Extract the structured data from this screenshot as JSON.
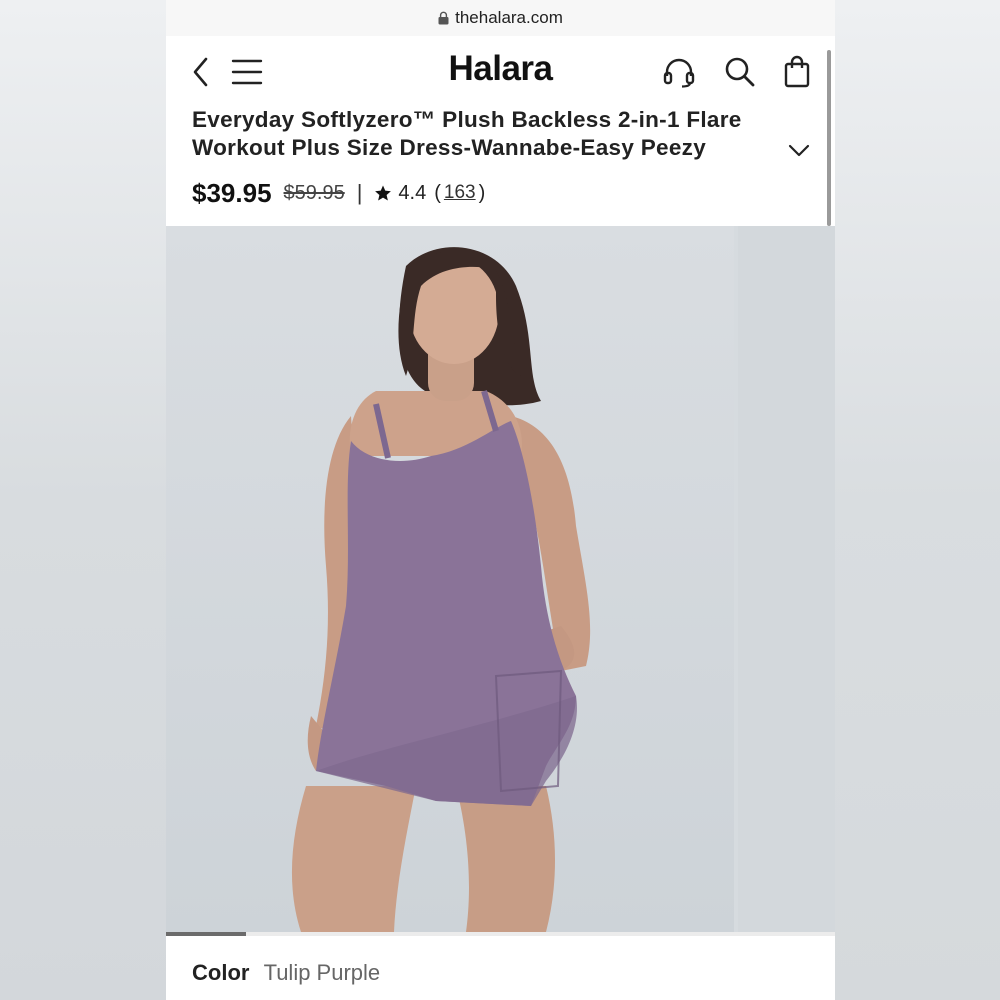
{
  "browser": {
    "url": "thehalara.com",
    "lock_icon": "lock-icon"
  },
  "header": {
    "logo": "Halara",
    "icons": [
      "back-arrow-icon",
      "menu-icon",
      "headset-icon",
      "search-icon",
      "shopping-bag-icon"
    ]
  },
  "product": {
    "title": "Everyday Softlyzero™ Plush Backless 2-in-1 Flare Workout Plus Size Dress-Wannabe-Easy Peezy",
    "price": "$39.95",
    "original_price": "$59.95",
    "separator": "|",
    "rating": "4.4",
    "open_paren": "(",
    "review_count": "163",
    "close_paren": ")",
    "gallery_progress": 0.12,
    "color_label": "Color",
    "color_value": "Tulip Purple"
  },
  "colors": {
    "dress": "#8a7398",
    "background": "#d4d9dd",
    "accent": "#111111"
  }
}
